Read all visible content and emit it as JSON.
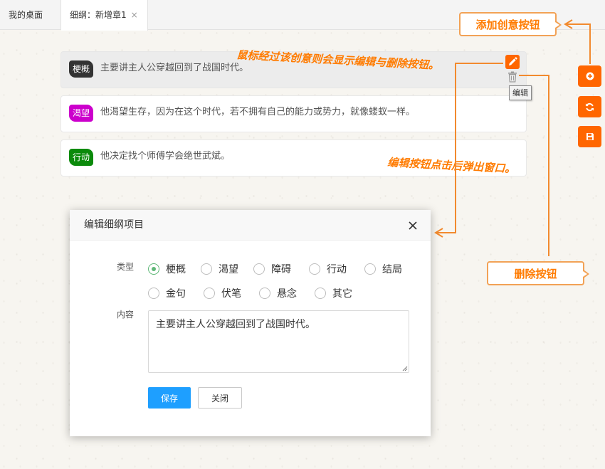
{
  "tabs": [
    {
      "label": "我的桌面"
    },
    {
      "label": "细纲：新增章1",
      "close": "×"
    }
  ],
  "cards": [
    {
      "tag": "梗概",
      "tag_color": "#333333",
      "text": "主要讲主人公穿越回到了战国时代。"
    },
    {
      "tag": "渴望",
      "tag_color": "#cc00cc",
      "text": "他渴望生存，因为在这个时代，若不拥有自己的能力或势力，就像蝼蚁一样。"
    },
    {
      "tag": "行动",
      "tag_color": "#0b8a0b",
      "text": "他决定找个师傅学会绝世武斌。"
    }
  ],
  "card_actions": {
    "edit_icon": "pencil-icon",
    "delete_icon": "trash-icon",
    "tooltip": "编辑"
  },
  "side_buttons": [
    {
      "icon": "plus-circle-icon"
    },
    {
      "icon": "refresh-icon"
    },
    {
      "icon": "save-icon"
    }
  ],
  "annotations": {
    "hover_note": "鼠标经过该创意则会显示编辑与删除按钮。",
    "popup_note": "编辑按钮点击后弹出窗口。",
    "add_callout": "添加创意按钮",
    "delete_callout": "删除按钮"
  },
  "dialog": {
    "title": "编辑细纲项目",
    "type_label": "类型",
    "content_label": "内容",
    "types": [
      "梗概",
      "渴望",
      "障碍",
      "行动",
      "结局",
      "金句",
      "伏笔",
      "悬念",
      "其它"
    ],
    "selected_type": "梗概",
    "content_value": "主要讲主人公穿越回到了战国时代。",
    "save_label": "保存",
    "close_label": "关闭"
  },
  "colors": {
    "accent": "#ff6600",
    "annotation": "#ff7b00",
    "primary": "#1e9fff",
    "radio_checked": "#5fb878"
  }
}
